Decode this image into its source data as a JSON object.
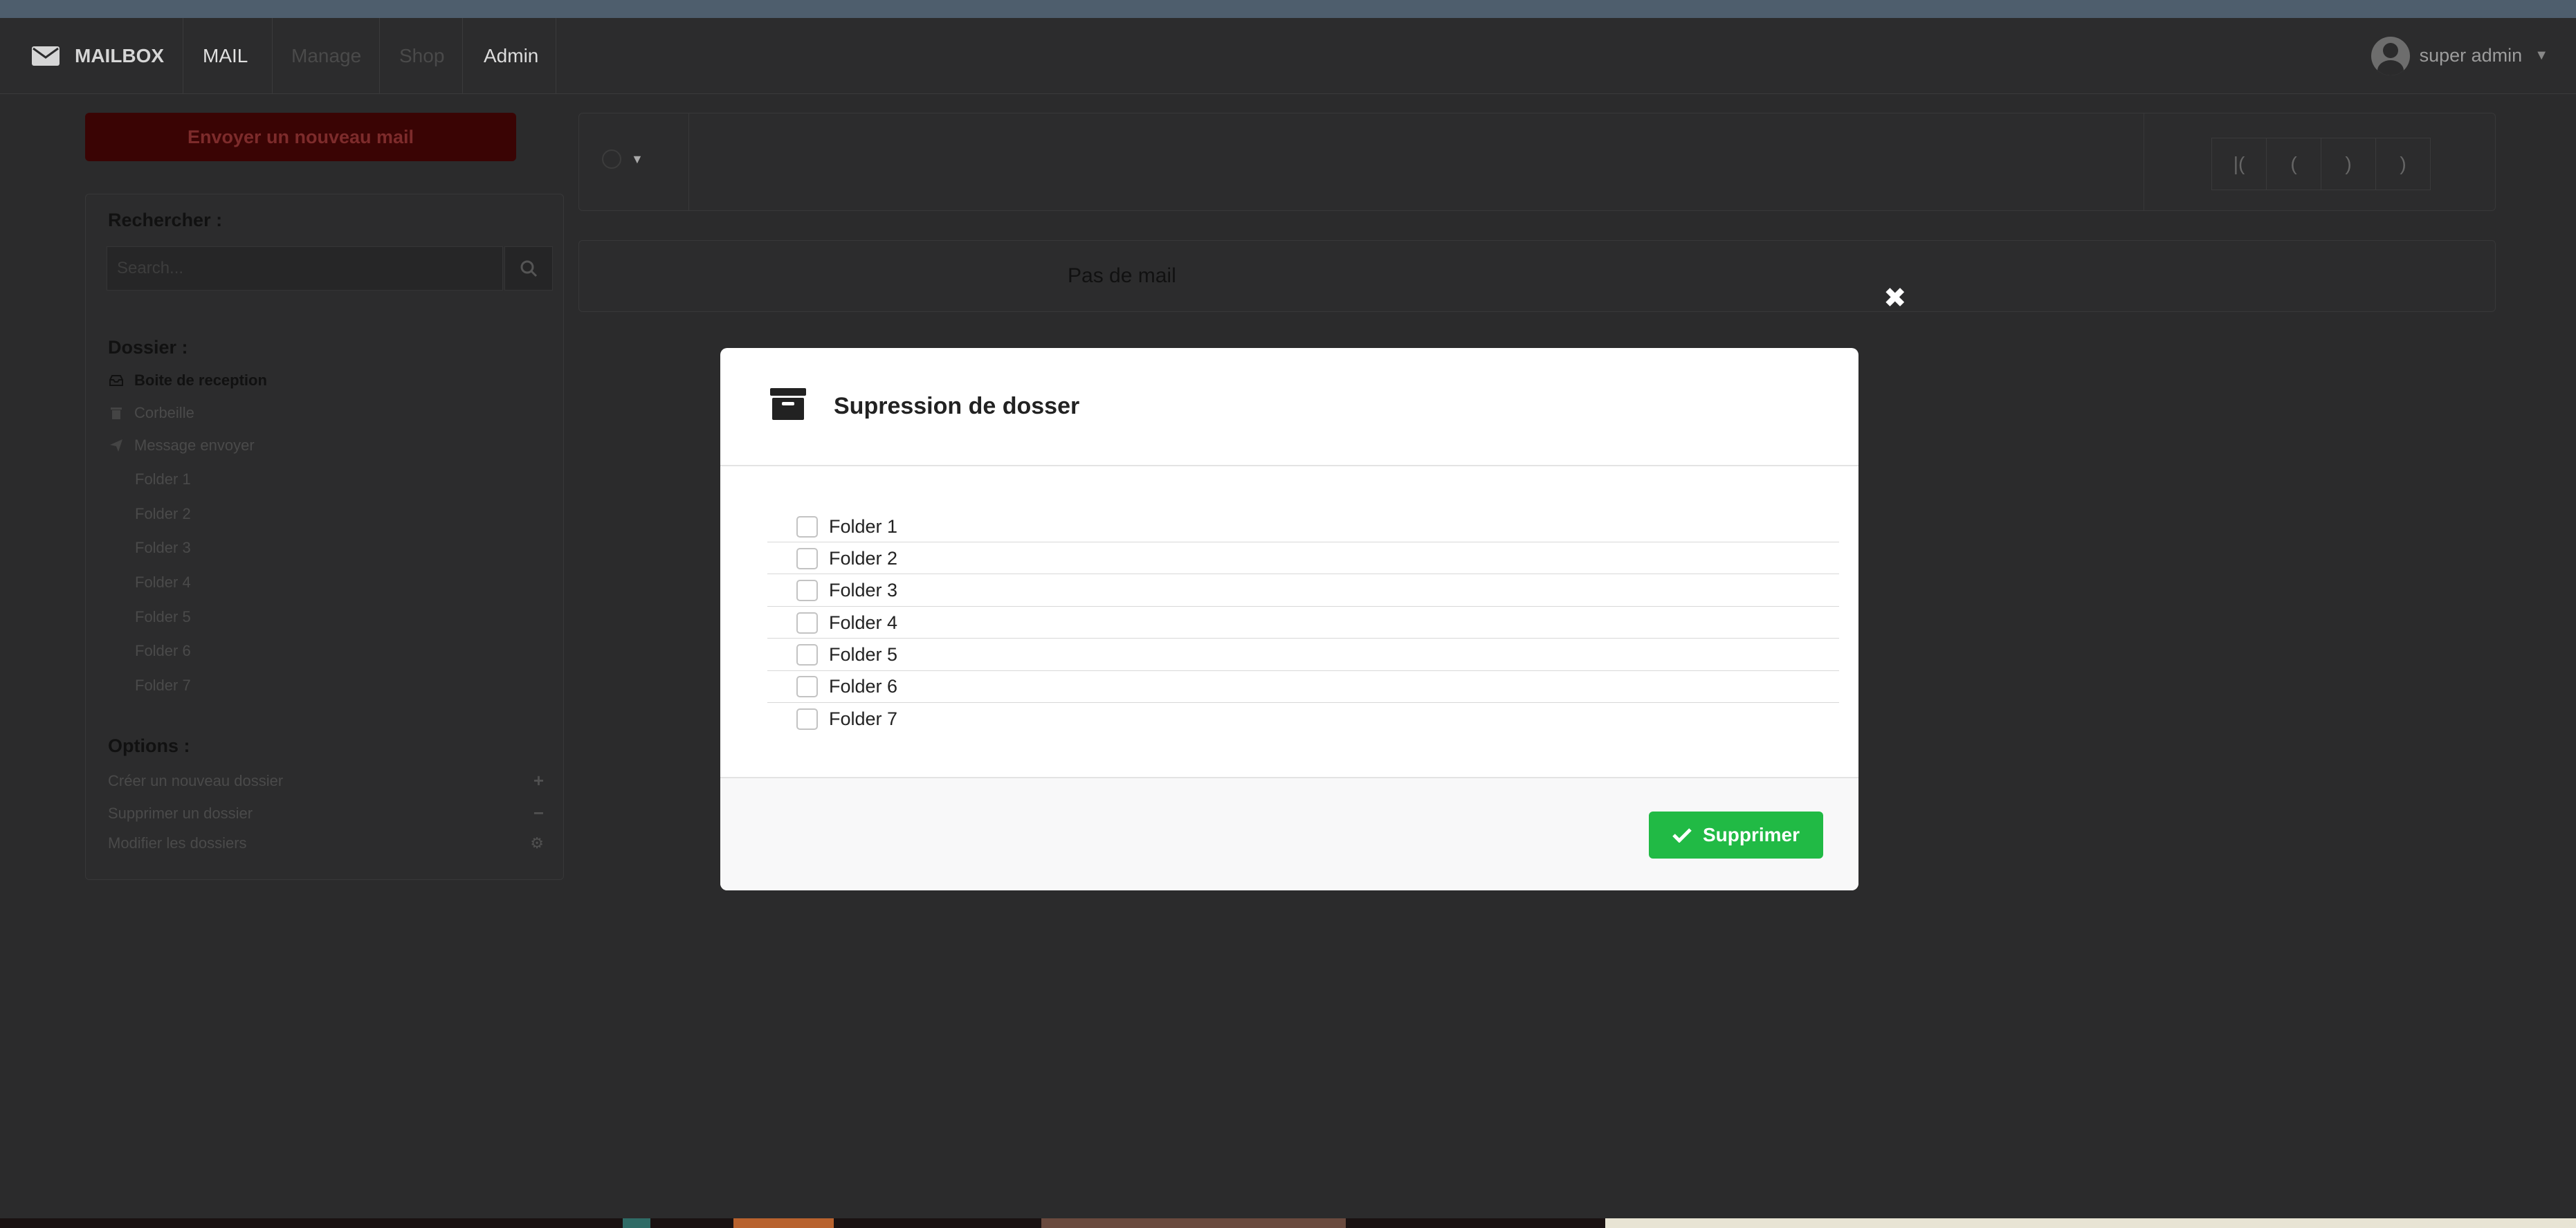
{
  "nav": {
    "brand": "MAILBOX",
    "items": [
      {
        "label": "MAIL",
        "state": "active"
      },
      {
        "label": "Manage",
        "state": "disabled"
      },
      {
        "label": "Shop",
        "state": "disabled"
      },
      {
        "label": "Admin",
        "state": "normal"
      }
    ],
    "user": "super admin"
  },
  "sidebar": {
    "compose_label": "Envoyer un nouveau mail",
    "search_heading": "Rechercher :",
    "search_placeholder": "Search...",
    "folders_heading": "Dossier :",
    "system_folders": [
      {
        "label": "Boite de reception",
        "icon": "inbox-icon",
        "active": true
      },
      {
        "label": "Corbeille",
        "icon": "trash-icon",
        "active": false
      },
      {
        "label": "Message envoyer",
        "icon": "paper-plane-icon",
        "active": false
      }
    ],
    "user_folders": [
      "Folder 1",
      "Folder 2",
      "Folder 3",
      "Folder 4",
      "Folder 5",
      "Folder 6",
      "Folder 7"
    ],
    "options_heading": "Options :",
    "options": [
      {
        "label": "Créer un nouveau dossier",
        "icon": "plus-icon"
      },
      {
        "label": "Supprimer un dossier",
        "icon": "minus-icon"
      },
      {
        "label": "Modifier les dossiers",
        "icon": "cogs-icon"
      }
    ]
  },
  "toolbar": {
    "pager": [
      "|(",
      "(",
      ")",
      ")"
    ]
  },
  "main": {
    "empty_text": "Pas de mail"
  },
  "modal": {
    "close_glyph": "✖",
    "title": "Supression de dosser",
    "folders": [
      "Folder 1",
      "Folder 2",
      "Folder 3",
      "Folder 4",
      "Folder 5",
      "Folder 6",
      "Folder 7"
    ],
    "delete_label": "Supprimer"
  },
  "colors": {
    "overlay": "#2b2b2c",
    "delete_button": "#21ba45",
    "compose_button_dimmed": "#3a0404"
  }
}
